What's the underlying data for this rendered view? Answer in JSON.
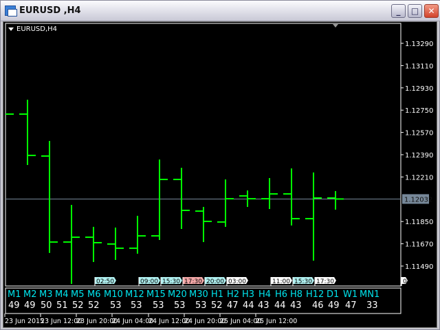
{
  "window": {
    "title": "EURUSD ,H4"
  },
  "chart": {
    "label": "EURUSD,H4",
    "colors": {
      "bars": "#00ff00",
      "background": "#000000",
      "grid": "#ffffff",
      "last_price_line": "#778899"
    },
    "last_price": "1.12032",
    "price_ticks": [
      "1.13290",
      "1.13110",
      "1.12930",
      "1.12750",
      "1.12570",
      "1.12390",
      "1.12210",
      "1.11850",
      "1.11670",
      "1.11490"
    ],
    "time_ticks": [
      "23 Jun 2015",
      "23 Jun 12:00",
      "23 Jun 20:00",
      "24 Jun 04:00",
      "24 Jun 12:00",
      "24 Jun 20:00",
      "25 Jun 04:00",
      "25 Jun 12:00"
    ]
  },
  "chart_data": {
    "type": "ohlc",
    "symbol": "EURUSD",
    "timeframe": "H4",
    "ylim": [
      1.11346,
      1.1329
    ],
    "previous_close": 1.12718,
    "bars": [
      {
        "o": 1.12718,
        "h": 1.12834,
        "l": 1.12307,
        "c": 1.12384
      },
      {
        "o": 1.12379,
        "h": 1.12501,
        "l": 1.11596,
        "c": 1.11684
      },
      {
        "o": 1.11684,
        "h": 1.11984,
        "l": 1.11346,
        "c": 1.11723
      },
      {
        "o": 1.11723,
        "h": 1.11807,
        "l": 1.11523,
        "c": 1.11679
      },
      {
        "o": 1.11668,
        "h": 1.11801,
        "l": 1.1154,
        "c": 1.11634
      },
      {
        "o": 1.11634,
        "h": 1.11896,
        "l": 1.1159,
        "c": 1.11734
      },
      {
        "o": 1.11734,
        "h": 1.12351,
        "l": 1.11701,
        "c": 1.1219
      },
      {
        "o": 1.1219,
        "h": 1.12284,
        "l": 1.1179,
        "c": 1.1194
      },
      {
        "o": 1.11934,
        "h": 1.11968,
        "l": 1.11684,
        "c": 1.11851
      },
      {
        "o": 1.11846,
        "h": 1.1219,
        "l": 1.11807,
        "c": 1.12034
      },
      {
        "o": 1.12057,
        "h": 1.12101,
        "l": 1.11968,
        "c": 1.12034
      },
      {
        "o": 1.12034,
        "h": 1.12201,
        "l": 1.11951,
        "c": 1.12073
      },
      {
        "o": 1.12073,
        "h": 1.12279,
        "l": 1.11818,
        "c": 1.11873
      },
      {
        "o": 1.11873,
        "h": 1.12246,
        "l": 1.11534,
        "c": 1.1204
      },
      {
        "o": 1.1204,
        "h": 1.12096,
        "l": 1.11946,
        "c": 1.12032
      }
    ]
  },
  "markers": [
    {
      "bar": 4,
      "text": "02:50",
      "color": "#b0f0f0"
    },
    {
      "bar": 6,
      "text": "09:00",
      "color": "#b0f0f0"
    },
    {
      "bar": 7,
      "text": "15:30",
      "color": "#b0f0f0"
    },
    {
      "bar": 8,
      "text": "17:30",
      "color": "#f4a8a8"
    },
    {
      "bar": 9,
      "text": "20:00",
      "color": "#b0f0f0"
    },
    {
      "bar": 10,
      "text": "03:00",
      "color": "#ffffff"
    },
    {
      "bar": 12,
      "text": "11:00",
      "color": "#ffffff"
    },
    {
      "bar": 13,
      "text": "15:30",
      "color": "#b0f0f0"
    },
    {
      "bar": 14,
      "text": "17:30",
      "color": "#ffffff"
    },
    {
      "bar": 17,
      "text": "0",
      "color": "#ffffff"
    }
  ],
  "panel": {
    "labels": [
      "M1",
      "M2",
      "M3",
      "M4",
      "M5",
      "M6",
      "M10",
      "M12",
      "M15",
      "M20",
      "M30",
      "H1",
      "H2",
      "H3",
      "H4",
      "H6",
      "H8",
      "H12",
      "D1",
      "W1",
      "MN1"
    ],
    "values": [
      "49",
      "49",
      "50",
      "51",
      "52",
      "52",
      "53",
      "53",
      "53",
      "53",
      "53",
      "52",
      "47",
      "44",
      "43",
      "44",
      "43",
      "46",
      "49",
      "47",
      "33"
    ]
  }
}
